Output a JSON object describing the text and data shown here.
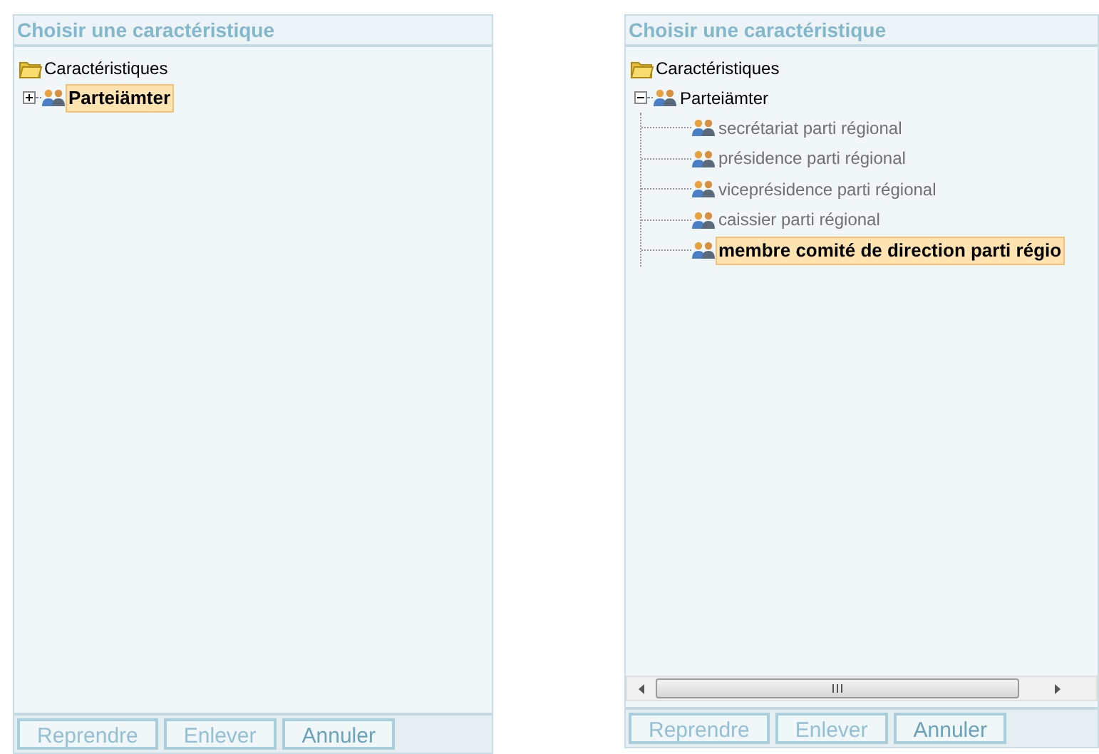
{
  "panels": [
    {
      "title": "Choisir une caractéristique",
      "horizontal_scrollbar": false,
      "tree": {
        "label": "Caractéristiques",
        "children": [
          {
            "label": "Parteiämter",
            "expanded": false,
            "selected": true,
            "disabled": false
          }
        ]
      },
      "buttons": [
        {
          "label": "Reprendre",
          "disabled": true
        },
        {
          "label": "Enlever",
          "disabled": true
        },
        {
          "label": "Annuler",
          "disabled": false
        }
      ]
    },
    {
      "title": "Choisir une caractéristique",
      "horizontal_scrollbar": true,
      "tree": {
        "label": "Caractéristiques",
        "children": [
          {
            "label": "Parteiämter",
            "expanded": true,
            "selected": false,
            "disabled": false,
            "children": [
              {
                "label": "secrétariat parti régional",
                "selected": false,
                "disabled": true
              },
              {
                "label": "présidence parti régional",
                "selected": false,
                "disabled": true
              },
              {
                "label": "viceprésidence parti régional",
                "selected": false,
                "disabled": true
              },
              {
                "label": "caissier parti régional",
                "selected": false,
                "disabled": true
              },
              {
                "label": "membre comité de direction parti régio",
                "selected": true,
                "disabled": false
              }
            ]
          }
        ]
      },
      "buttons": [
        {
          "label": "Reprendre",
          "disabled": true
        },
        {
          "label": "Enlever",
          "disabled": true
        },
        {
          "label": "Annuler",
          "disabled": false
        }
      ]
    }
  ]
}
